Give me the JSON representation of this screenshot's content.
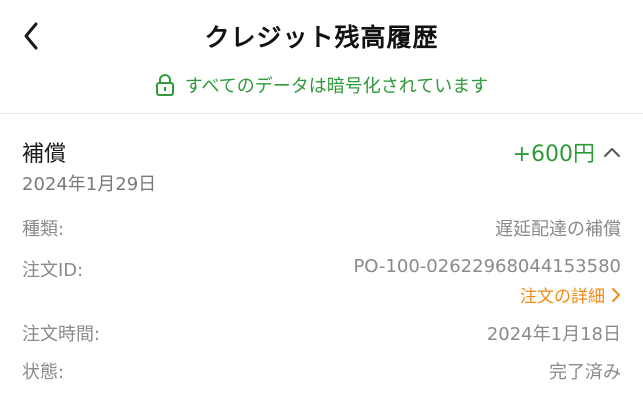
{
  "header": {
    "title": "クレジット残高履歴",
    "back_icon": "chevron-left-icon"
  },
  "secure_banner": {
    "icon": "lock-icon",
    "text": "すべてのデータは暗号化されています",
    "color": "#2f9a3a"
  },
  "record": {
    "type": "補償",
    "date": "2024年1月29日",
    "amount": "+600円",
    "amount_color": "#2f9a3a",
    "toggle_icon": "chevron-up-icon",
    "details": [
      {
        "label": "種類:",
        "value": "遅延配達の補償"
      },
      {
        "label": "注文ID:",
        "value": "PO-100-02622968044153580"
      },
      {
        "label": "注文時間:",
        "value": "2024年1月18日"
      },
      {
        "label": "状態:",
        "value": "完了済み"
      }
    ],
    "order_link": {
      "label": "注文の詳細",
      "icon": "chevron-right-icon",
      "color": "#f08a1c"
    }
  }
}
